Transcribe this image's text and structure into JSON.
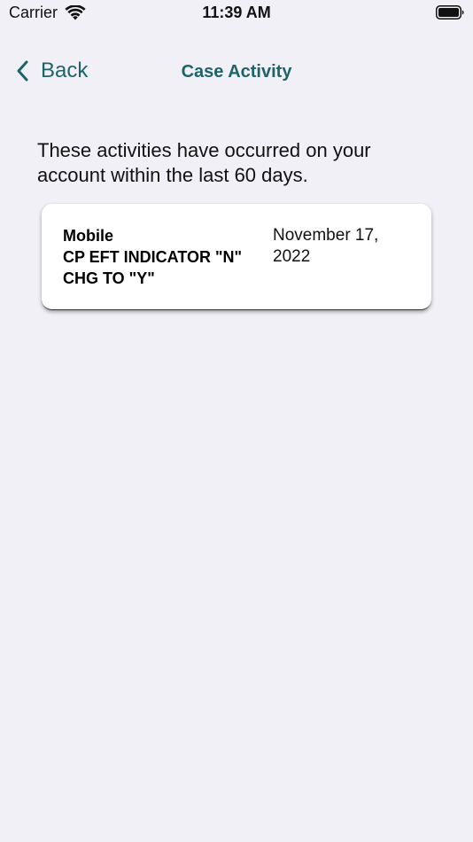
{
  "status_bar": {
    "carrier": "Carrier",
    "time": "11:39 AM"
  },
  "nav": {
    "back_label": "Back",
    "title": "Case Activity"
  },
  "intro_text": "These activities have occurred on your account within the last 60 days.",
  "activities": [
    {
      "description": "Mobile\nCP EFT INDICATOR \"N\"\nCHG TO \"Y\"",
      "date": "November 17, 2022"
    }
  ],
  "colors": {
    "accent": "#1d6468",
    "background": "#f1f0f6",
    "card": "#ffffff"
  }
}
